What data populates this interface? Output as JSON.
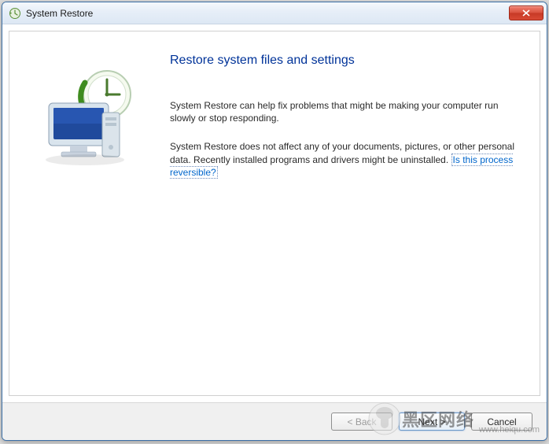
{
  "window": {
    "title": "System Restore"
  },
  "main": {
    "heading": "Restore system files and settings",
    "para1": "System Restore can help fix problems that might be making your computer run slowly or stop responding.",
    "para2_prefix": "System Restore does not affect any of your documents, pictures, or other personal data. Recently installed programs and drivers might be uninstalled. ",
    "link_text": "Is this process reversible?"
  },
  "buttons": {
    "back": "< Back",
    "next": "Next >",
    "cancel": "Cancel"
  },
  "watermark": {
    "text": "黑区网络",
    "url": "www.heiqu.com"
  }
}
